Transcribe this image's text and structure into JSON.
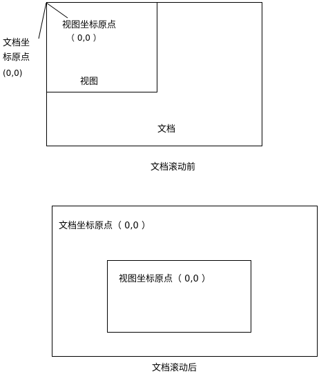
{
  "before": {
    "doc_origin_label_line1": "文档坐",
    "doc_origin_label_line2": "标原点",
    "doc_origin_coords": "(0,0)",
    "view_origin_label": "视图坐标原点",
    "view_origin_coords": "（ 0,0 ）",
    "view_label": "视图",
    "document_label": "文档",
    "caption": "文档滚动前"
  },
  "after": {
    "doc_origin_label": "文档坐标原点（ 0,0 ）",
    "view_origin_label": "视图坐标原点（ 0,0 ）",
    "caption": "文档滚动后"
  }
}
